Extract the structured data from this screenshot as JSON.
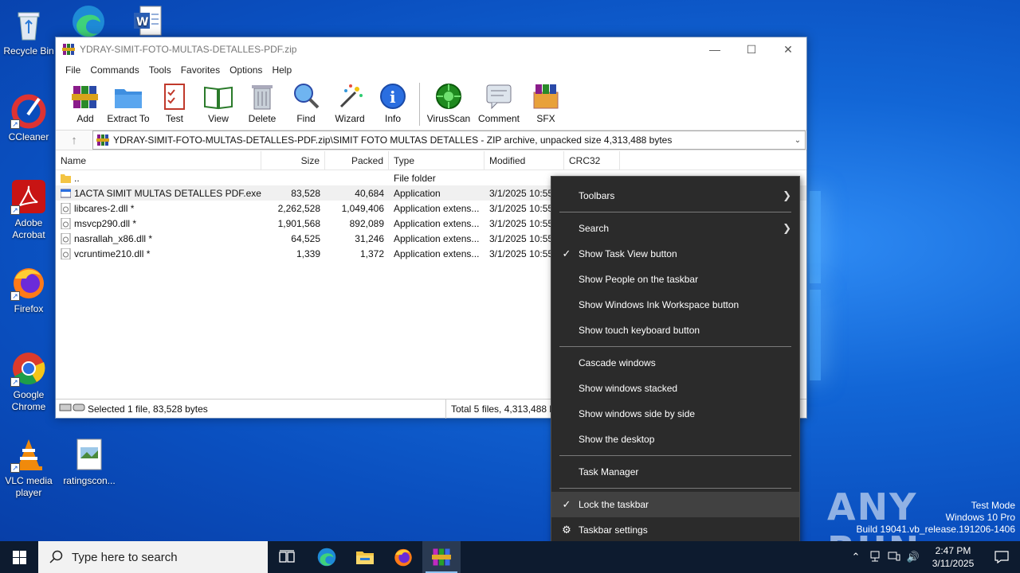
{
  "desktop": {
    "icons": [
      {
        "label": "Recycle Bin"
      },
      {
        "label": "CCleaner"
      },
      {
        "label": "Adobe Acrobat"
      },
      {
        "label": "Firefox"
      },
      {
        "label": "Google Chrome"
      },
      {
        "label": "VLC media player"
      },
      {
        "label": "ratingscon..."
      }
    ]
  },
  "window": {
    "title": "YDRAY-SIMIT-FOTO-MULTAS-DETALLES-PDF.zip",
    "menu": [
      "File",
      "Commands",
      "Tools",
      "Favorites",
      "Options",
      "Help"
    ],
    "toolbar": [
      "Add",
      "Extract To",
      "Test",
      "View",
      "Delete",
      "Find",
      "Wizard",
      "Info",
      "VirusScan",
      "Comment",
      "SFX"
    ],
    "path": "YDRAY-SIMIT-FOTO-MULTAS-DETALLES-PDF.zip\\SIMIT FOTO MULTAS DETALLES - ZIP archive, unpacked size 4,313,488 bytes",
    "columns": {
      "name": "Name",
      "size": "Size",
      "packed": "Packed",
      "type": "Type",
      "modified": "Modified",
      "crc": "CRC32"
    },
    "rows": [
      {
        "name": "..",
        "size": "",
        "packed": "",
        "type": "File folder",
        "modified": "",
        "icon": "folder-icon"
      },
      {
        "name": "1ACTA SIMIT MULTAS DETALLES PDF.exe *",
        "size": "83,528",
        "packed": "40,684",
        "type": "Application",
        "modified": "3/1/2025 10:55",
        "icon": "exe-icon"
      },
      {
        "name": "libcares-2.dll *",
        "size": "2,262,528",
        "packed": "1,049,406",
        "type": "Application extens...",
        "modified": "3/1/2025 10:55",
        "icon": "dll-icon"
      },
      {
        "name": "msvcp290.dll *",
        "size": "1,901,568",
        "packed": "892,089",
        "type": "Application extens...",
        "modified": "3/1/2025 10:55",
        "icon": "dll-icon"
      },
      {
        "name": "nasrallah_x86.dll *",
        "size": "64,525",
        "packed": "31,246",
        "type": "Application extens...",
        "modified": "3/1/2025 10:55",
        "icon": "dll-icon"
      },
      {
        "name": "vcruntime210.dll *",
        "size": "1,339",
        "packed": "1,372",
        "type": "Application extens...",
        "modified": "3/1/2025 10:55",
        "icon": "dll-icon"
      }
    ],
    "status_left": "Selected 1 file, 83,528 bytes",
    "status_right": "Total 5 files, 4,313,488 by"
  },
  "context_menu": {
    "items": [
      {
        "label": "Toolbars",
        "submenu": true
      },
      {
        "sep": true
      },
      {
        "label": "Search",
        "submenu": true
      },
      {
        "label": "Show Task View button",
        "checked": true
      },
      {
        "label": "Show People on the taskbar"
      },
      {
        "label": "Show Windows Ink Workspace button"
      },
      {
        "label": "Show touch keyboard button"
      },
      {
        "sep": true
      },
      {
        "label": "Cascade windows"
      },
      {
        "label": "Show windows stacked"
      },
      {
        "label": "Show windows side by side"
      },
      {
        "label": "Show the desktop"
      },
      {
        "sep": true
      },
      {
        "label": "Task Manager"
      },
      {
        "sep": true
      },
      {
        "label": "Lock the taskbar",
        "checked": true,
        "highlighted": true
      },
      {
        "label": "Taskbar settings",
        "gear": true
      }
    ]
  },
  "watermark": {
    "brand": "ANY RUN",
    "line1": "Test Mode",
    "line2": "Windows 10 Pro",
    "line3": "Build 19041.vb_release.191206-1406"
  },
  "taskbar": {
    "search_placeholder": "Type here to search",
    "time": "2:47 PM",
    "date": "3/11/2025"
  }
}
